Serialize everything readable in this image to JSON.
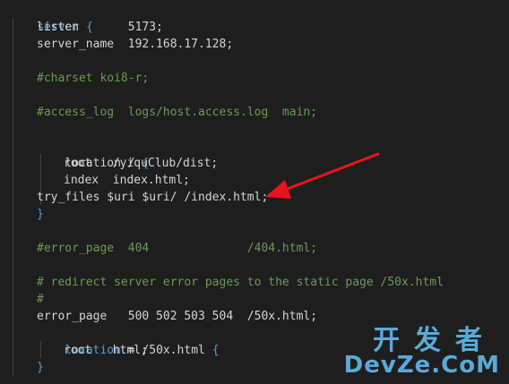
{
  "code": {
    "l1_kw": "server",
    "l1_brace": " {",
    "l2": "listen       5173;",
    "l3": "server_name  192.168.17.128;",
    "l4": "#charset koi8-r;",
    "l5": "#access_log  logs/host.access.log  main;",
    "l6_a": "location / ",
    "l6_b": "{",
    "l7": "root   /yiquClub/dist;",
    "l8": "index  index.html;",
    "l9": "try_files $uri $uri/ /index.html;",
    "l10": "}",
    "l11": "#error_page  404              /404.html;",
    "l12": "# redirect server error pages to the static page /50x.html",
    "l13": "#",
    "l14": "error_page   500 502 503 504  /50x.html;",
    "l15_kw": "location",
    "l15_rest": " = /50x.html ",
    "l15_brace": "{",
    "l16": "root   html;",
    "l17": "}"
  },
  "watermark": {
    "cn": "开发者",
    "en": "DevZe.CoM"
  },
  "colors": {
    "background": "#1e1e1e",
    "keyword": "#569cd6",
    "comment": "#6a9955",
    "text": "#d4d4d4",
    "arrow": "#e8141b",
    "watermark": "#5aa9d9"
  },
  "icons": {
    "annotation": "red-arrow-icon"
  }
}
